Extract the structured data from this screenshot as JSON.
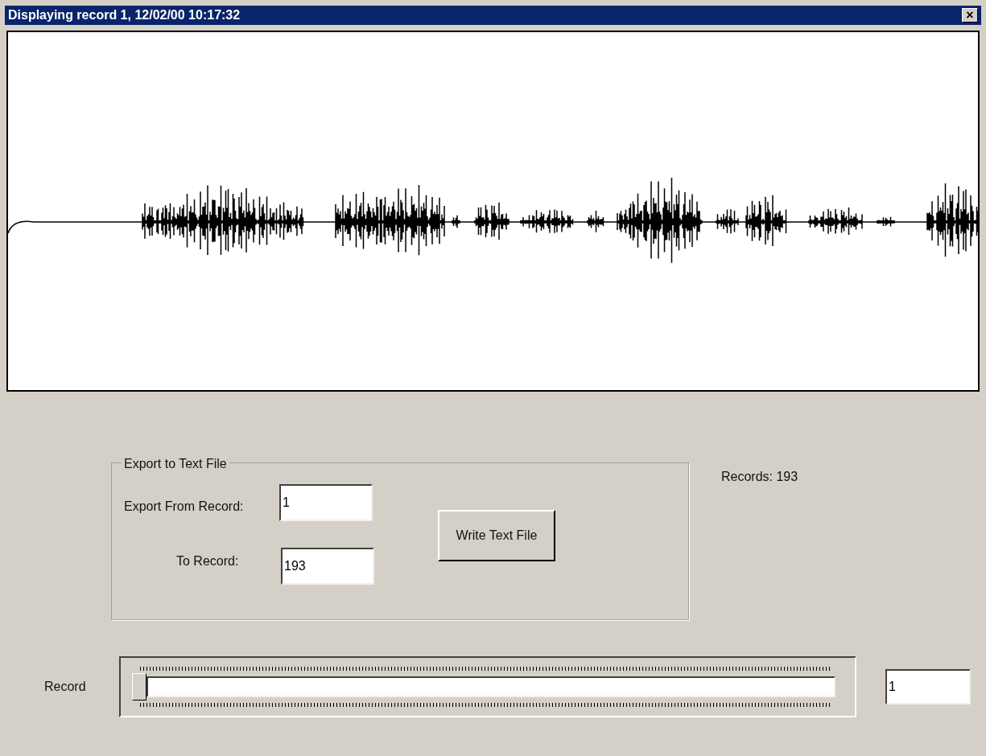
{
  "window": {
    "title": "Displaying record 1, 12/02/00 10:17:32",
    "close_button": "×"
  },
  "export_group": {
    "title": "Export to Text File",
    "from_label": "Export From Record:",
    "from_value": "1",
    "to_label": "To Record:",
    "to_value": "193",
    "button": "Write Text File"
  },
  "records_count": "Records: 193",
  "record_slider": {
    "label": "Record",
    "level": 0,
    "value": "1"
  }
}
